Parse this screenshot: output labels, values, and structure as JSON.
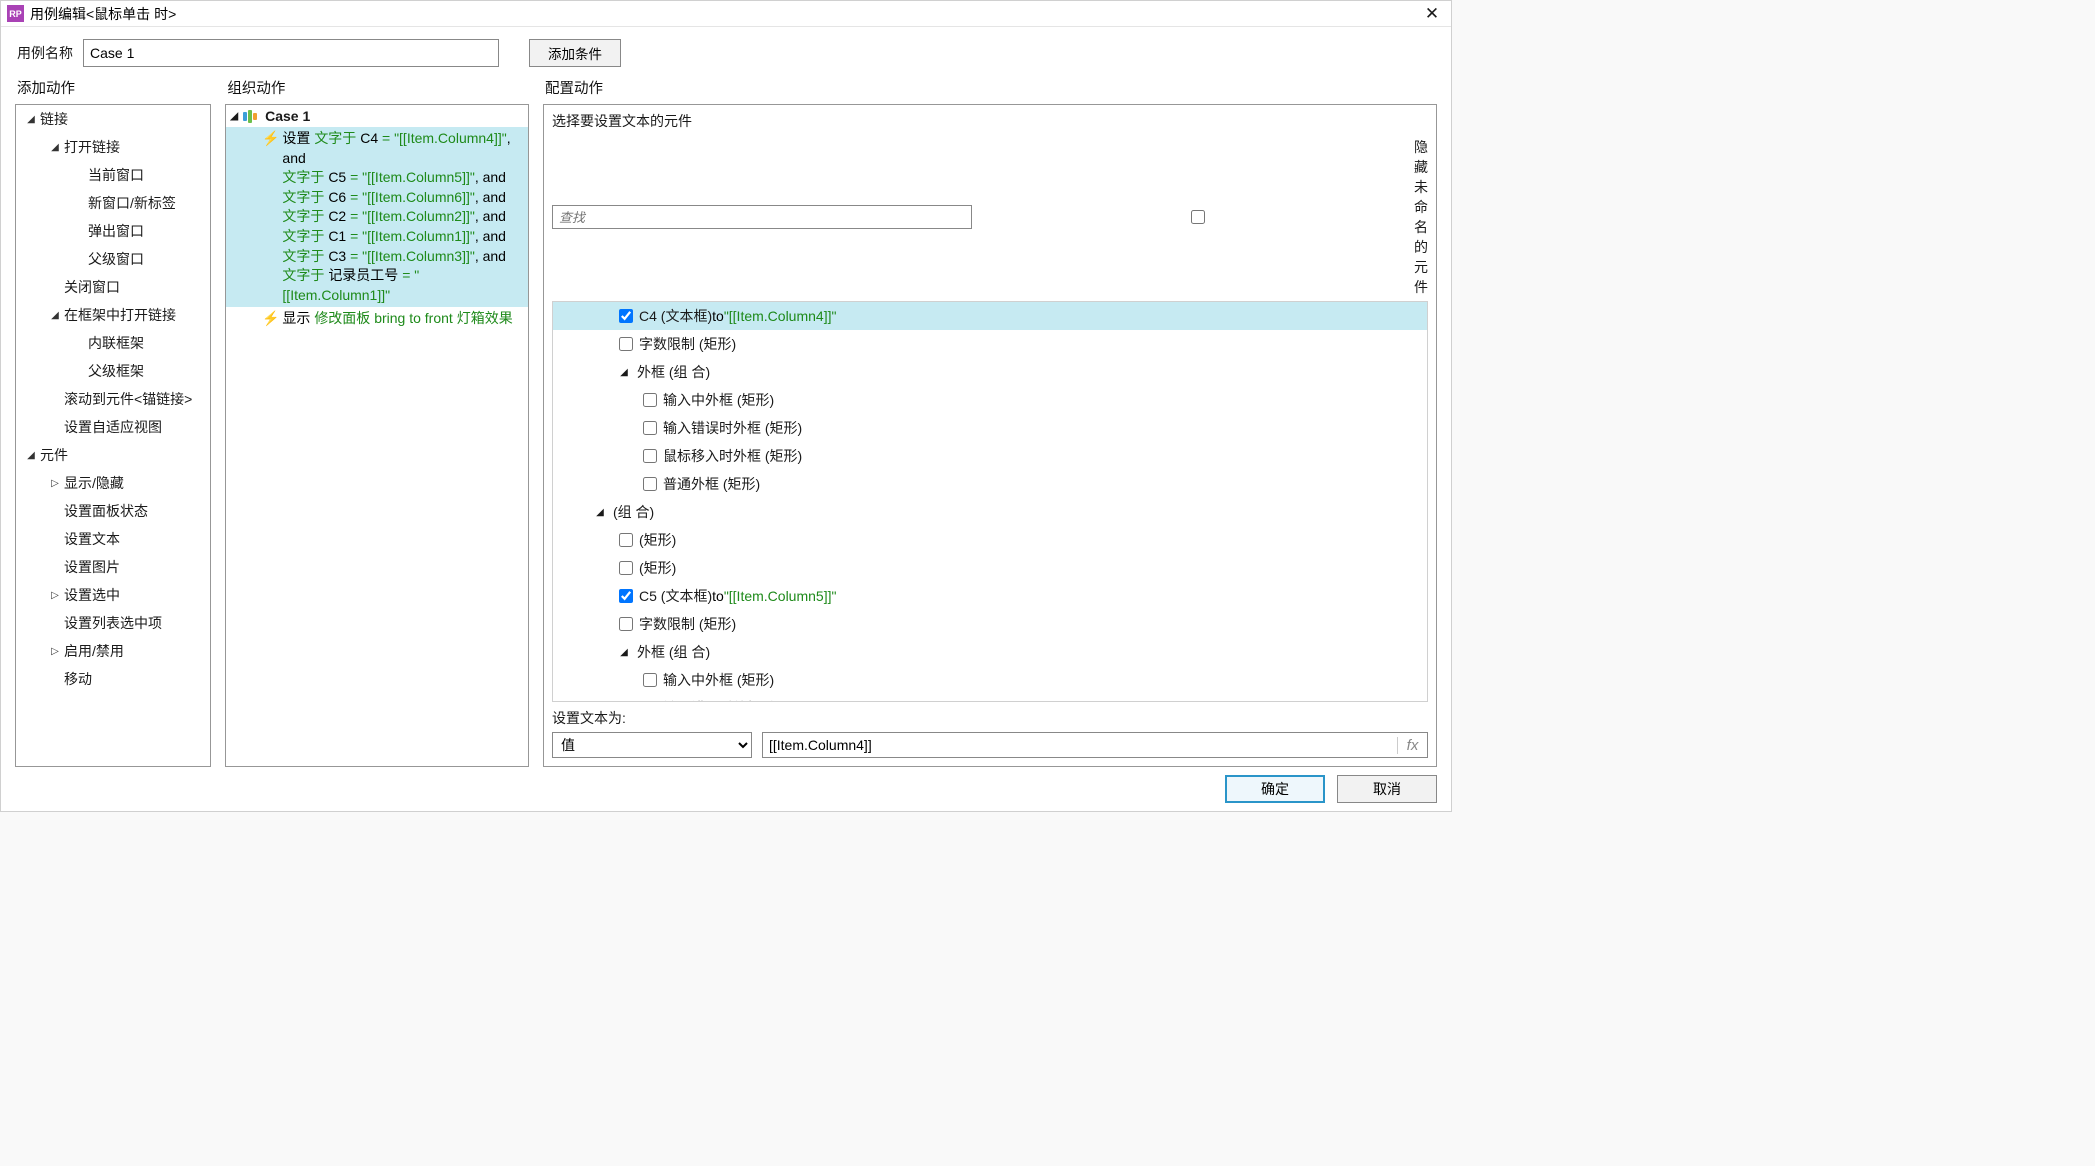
{
  "titlebar": {
    "title": "用例编辑<鼠标单击 时>"
  },
  "header": {
    "case_name_label": "用例名称",
    "case_name_value": "Case 1",
    "add_condition_btn": "添加条件"
  },
  "panels": {
    "add_title": "添加动作",
    "org_title": "组织动作",
    "cfg_title": "配置动作"
  },
  "add_tree": {
    "i0": "链接",
    "i1": "打开链接",
    "i2": "当前窗口",
    "i3": "新窗口/新标签",
    "i4": "弹出窗口",
    "i5": "父级窗口",
    "i6": "关闭窗口",
    "i7": "在框架中打开链接",
    "i8": "内联框架",
    "i9": "父级框架",
    "i10": "滚动到元件<锚链接>",
    "i11": "设置自适应视图",
    "i12": "元件",
    "i13": "显示/隐藏",
    "i14": "设置面板状态",
    "i15": "设置文本",
    "i16": "设置图片",
    "i17": "设置选中",
    "i18": "设置列表选中项",
    "i19": "启用/禁用",
    "i20": "移动"
  },
  "org": {
    "case_name": "Case 1",
    "a1": {
      "prefix": "设置 ",
      "lines": [
        {
          "at": "文字于 ",
          "field": "C4",
          "eqv": " = \"[[Item.Column4]]\"",
          "tail": ", and"
        },
        {
          "at": "文字于 ",
          "field": "C5",
          "eqv": " = \"[[Item.Column5]]\"",
          "tail": ", and"
        },
        {
          "at": "文字于 ",
          "field": "C6",
          "eqv": " = \"[[Item.Column6]]\"",
          "tail": ", and"
        },
        {
          "at": "文字于 ",
          "field": "C2",
          "eqv": " = \"[[Item.Column2]]\"",
          "tail": ", and"
        },
        {
          "at": "文字于 ",
          "field": "C1",
          "eqv": " = \"[[Item.Column1]]\"",
          "tail": ", and"
        },
        {
          "at": "文字于 ",
          "field": "C3",
          "eqv": " = \"[[Item.Column3]]\"",
          "tail": ", and"
        },
        {
          "at": "文字于 ",
          "field": "记录员工号",
          "eqv": " = \"[[Item.Column1]]\"",
          "tail": ""
        }
      ]
    },
    "a2": {
      "prefix": "显示 ",
      "rest": "修改面板 bring to front 灯箱效果"
    }
  },
  "cfg": {
    "select_label": "选择要设置文本的元件",
    "search_placeholder": "查找",
    "hide_unnamed": "隐藏未命名的元件",
    "rows": {
      "r0_name": "C4 (文本框)",
      "r0_to": " to ",
      "r0_val": "\"[[Item.Column4]]\"",
      "r1_name": "字数限制 (矩形)",
      "r2_name": "外框 (组 合)",
      "r3_name": "输入中外框 (矩形)",
      "r4_name": "输入错误时外框 (矩形)",
      "r5_name": "鼠标移入时外框 (矩形)",
      "r6_name": "普通外框 (矩形)",
      "r7_name": "(组 合)",
      "r8_name": "(矩形)",
      "r9_name": "(矩形)",
      "r10_name": "C5 (文本框)",
      "r10_to": " to ",
      "r10_val": "\"[[Item.Column5]]\"",
      "r11_name": "字数限制 (矩形)",
      "r12_name": "外框 (组 合)",
      "r13_name": "输入中外框 (矩形)",
      "r14_name": "输入错误时外框 (矩形)"
    },
    "set_text_label": "设置文本为:",
    "value_type": "值",
    "value_expr": "[[Item.Column4]]"
  },
  "footer": {
    "ok": "确定",
    "cancel": "取消"
  }
}
